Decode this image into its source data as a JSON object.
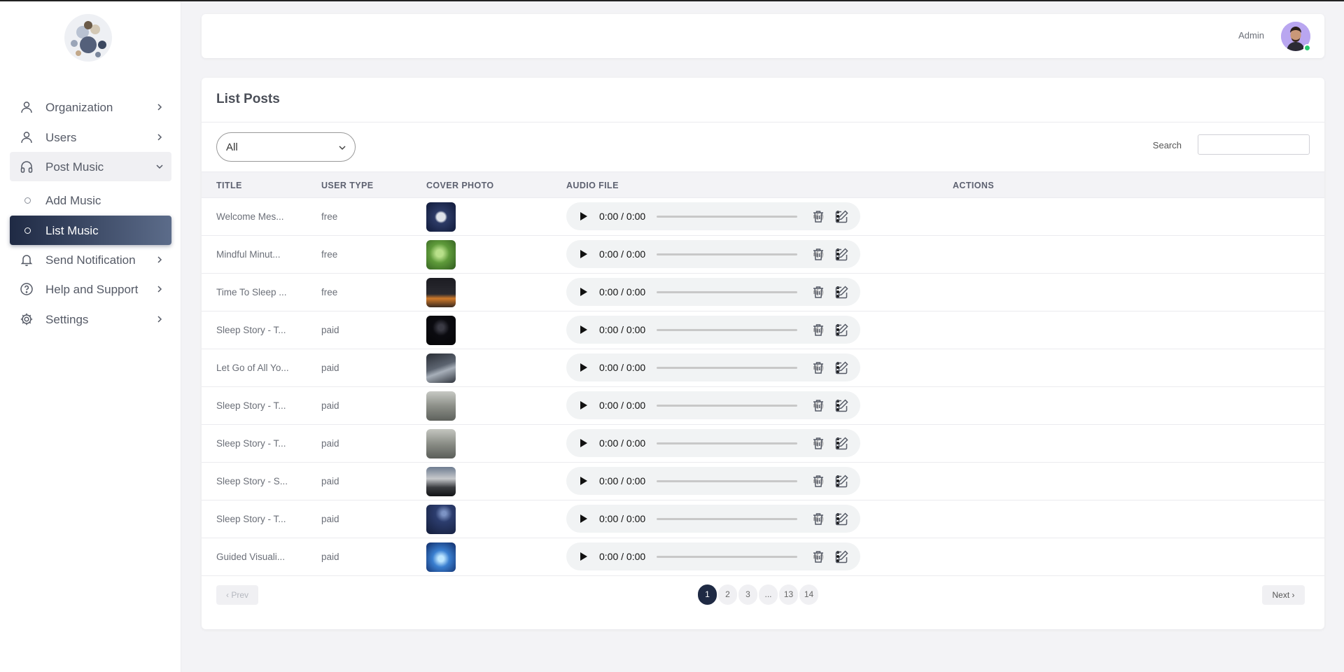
{
  "sidebar": {
    "items": [
      {
        "label": "Organization",
        "icon": "user-icon"
      },
      {
        "label": "Users",
        "icon": "user-icon"
      },
      {
        "label": "Post Music",
        "icon": "headphones-icon"
      },
      {
        "label": "Add Music",
        "icon": "circle-icon"
      },
      {
        "label": "List Music",
        "icon": "circle-icon"
      },
      {
        "label": "Send Notification",
        "icon": "bell-icon"
      },
      {
        "label": "Help and Support",
        "icon": "help-circle-icon"
      },
      {
        "label": "Settings",
        "icon": "gear-icon"
      }
    ]
  },
  "header": {
    "user_label": "Admin",
    "status_color": "#28c76f"
  },
  "main": {
    "title": "List Posts",
    "filter": {
      "selected": "All"
    },
    "search": {
      "label": "Search",
      "placeholder": ""
    },
    "columns": [
      "TITLE",
      "USER TYPE",
      "COVER PHOTO",
      "AUDIO FILE",
      "ACTIONS"
    ],
    "rows": [
      {
        "title": "Welcome Mes...",
        "user_type": "free",
        "audio_time": "0:00 / 0:00"
      },
      {
        "title": "Mindful Minut...",
        "user_type": "free",
        "audio_time": "0:00 / 0:00"
      },
      {
        "title": "Time To Sleep ...",
        "user_type": "free",
        "audio_time": "0:00 / 0:00"
      },
      {
        "title": "Sleep Story - T...",
        "user_type": "paid",
        "audio_time": "0:00 / 0:00"
      },
      {
        "title": "Let Go of All Yo...",
        "user_type": "paid",
        "audio_time": "0:00 / 0:00"
      },
      {
        "title": "Sleep Story - T...",
        "user_type": "paid",
        "audio_time": "0:00 / 0:00"
      },
      {
        "title": "Sleep Story - T...",
        "user_type": "paid",
        "audio_time": "0:00 / 0:00"
      },
      {
        "title": "Sleep Story - S...",
        "user_type": "paid",
        "audio_time": "0:00 / 0:00"
      },
      {
        "title": "Sleep Story - T...",
        "user_type": "paid",
        "audio_time": "0:00 / 0:00"
      },
      {
        "title": "Guided Visuali...",
        "user_type": "paid",
        "audio_time": "0:00 / 0:00"
      }
    ],
    "pagination": {
      "prev": "‹ Prev",
      "next": "Next ›",
      "pages": [
        "1",
        "2",
        "3",
        "...",
        "13",
        "14"
      ],
      "current": "1"
    }
  },
  "colors": {
    "accent": "#1f2a44",
    "active_gradient_end": "#5c6c8a"
  }
}
